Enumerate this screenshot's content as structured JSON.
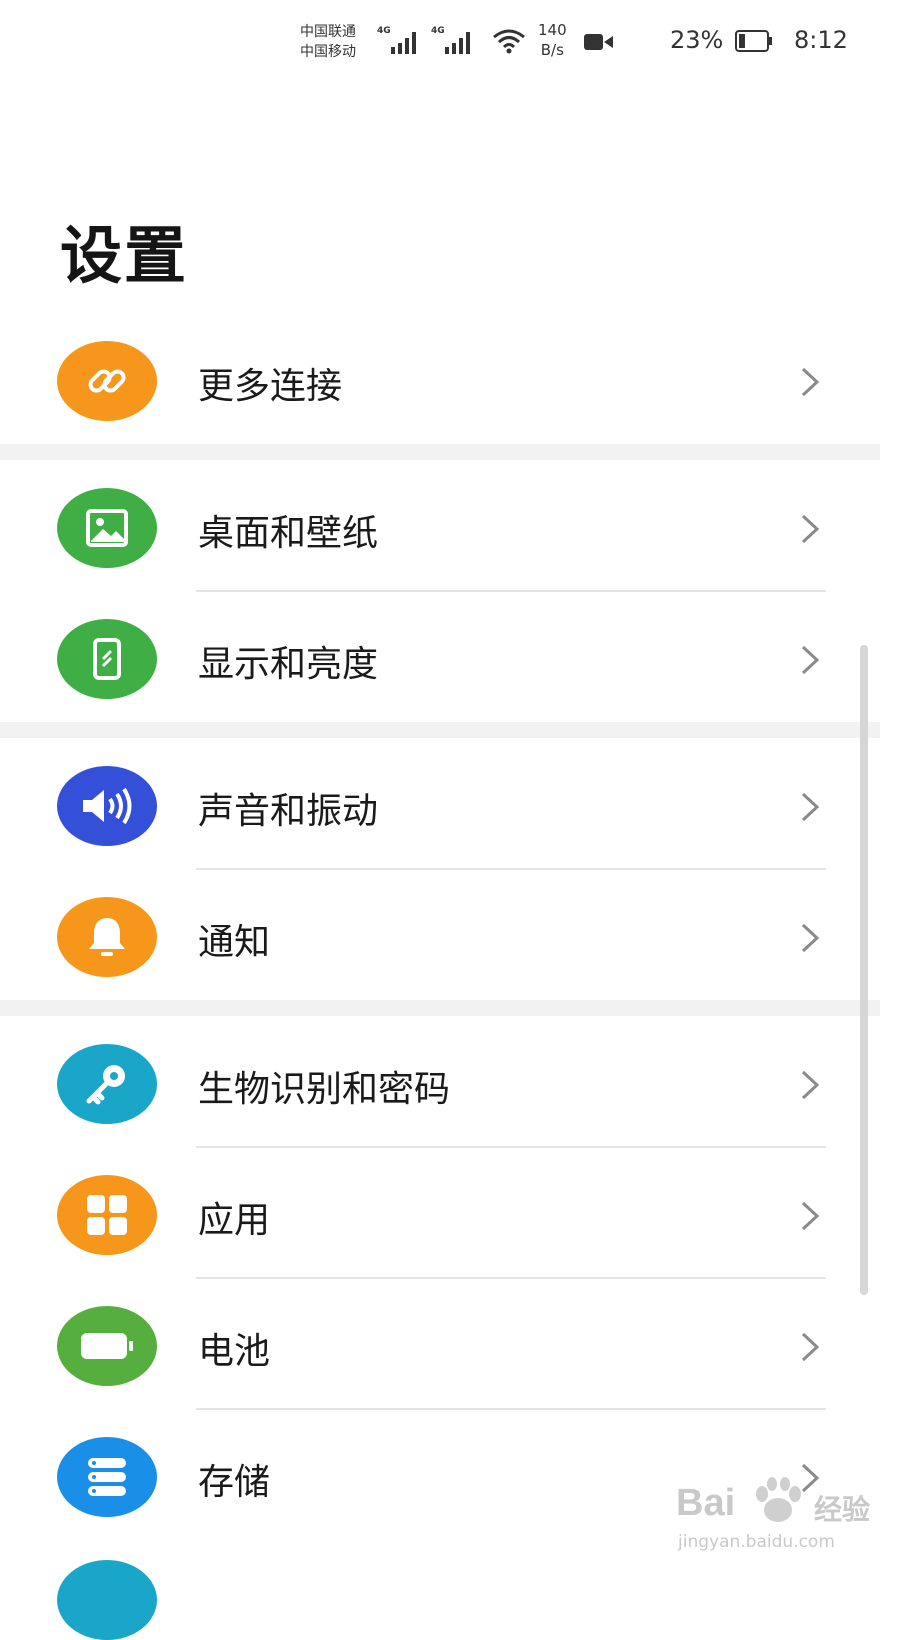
{
  "status_bar": {
    "carrier_1": "中国联通",
    "carrier_2": "中国移动",
    "network_1": "4G",
    "network_2": "4G",
    "speed_value": "140",
    "speed_unit": "B/s",
    "battery_percent": "23%",
    "battery_level": 0.23,
    "time": "8:12",
    "icons": [
      "signal-icon",
      "signal-icon",
      "wifi-icon",
      "video-camera-icon",
      "battery-icon"
    ]
  },
  "page": {
    "title": "设置"
  },
  "settings_items": [
    {
      "label": "更多连接",
      "icon": "link-icon",
      "color": "#F6961A"
    },
    {
      "label": "桌面和壁纸",
      "icon": "image-icon",
      "color": "#3EAE45"
    },
    {
      "label": "显示和亮度",
      "icon": "phone-brightness-icon",
      "color": "#3EAE45"
    },
    {
      "label": "声音和振动",
      "icon": "speaker-icon",
      "color": "#3550D8"
    },
    {
      "label": "通知",
      "icon": "bell-icon",
      "color": "#F6961A"
    },
    {
      "label": "生物识别和密码",
      "icon": "key-icon",
      "color": "#19A6C8"
    },
    {
      "label": "应用",
      "icon": "apps-grid-icon",
      "color": "#F6961A"
    },
    {
      "label": "电池",
      "icon": "battery-icon",
      "color": "#56AE3E"
    },
    {
      "label": "存储",
      "icon": "storage-icon",
      "color": "#1A8FE8"
    }
  ],
  "watermark": {
    "brand": "Bai",
    "brand_suffix": "经验",
    "url": "jingyan.baidu.com"
  }
}
